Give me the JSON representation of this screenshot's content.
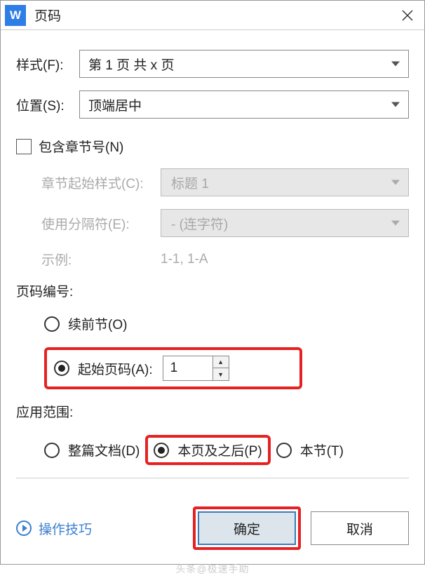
{
  "titlebar": {
    "icon_text": "W",
    "title": "页码"
  },
  "format": {
    "label": "样式(F):",
    "value": "第 1 页 共 x 页"
  },
  "position": {
    "label": "位置(S):",
    "value": "顶端居中"
  },
  "include_chapter": {
    "label": "包含章节号(N)"
  },
  "chapter_style": {
    "label": "章节起始样式(C):",
    "value": "标题 1"
  },
  "separator": {
    "label": "使用分隔符(E):",
    "value": "-    (连字符)"
  },
  "example": {
    "label": "示例:",
    "value": "1-1, 1-A"
  },
  "page_numbering": {
    "label": "页码编号:"
  },
  "continue_prev": {
    "label": "续前节(O)"
  },
  "start_at": {
    "label": "起始页码(A):",
    "value": "1"
  },
  "scope": {
    "label": "应用范围:"
  },
  "scope_whole": {
    "label": "整篇文档(D)"
  },
  "scope_after": {
    "label": "本页及之后(P)"
  },
  "scope_section": {
    "label": "本节(T)"
  },
  "tips": {
    "label": "操作技巧"
  },
  "buttons": {
    "ok": "确定",
    "cancel": "取消"
  },
  "watermark": "头条@极速手助"
}
